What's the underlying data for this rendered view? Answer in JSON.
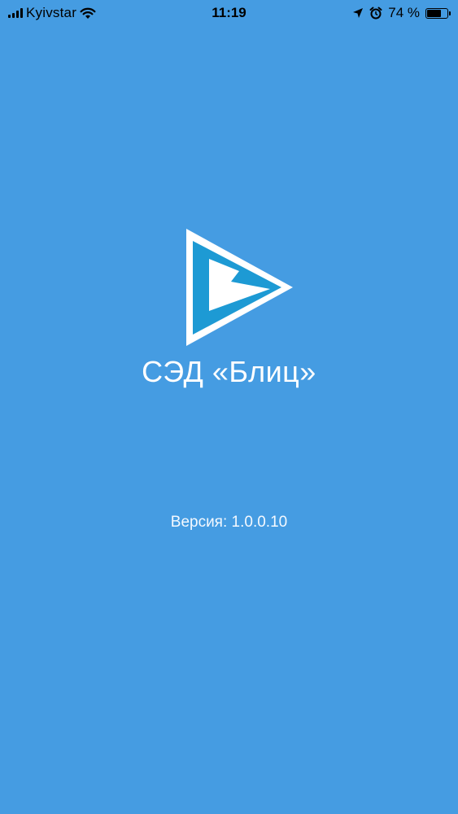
{
  "status_bar": {
    "carrier": "Kyivstar",
    "time": "11:19",
    "battery_percent": "74 %",
    "battery_level": 0.74,
    "signal_icon": "signal-bars-icon",
    "wifi_icon": "wifi-icon",
    "location_icon": "location-arrow-icon",
    "alarm_icon": "alarm-clock-icon",
    "battery_icon": "battery-icon"
  },
  "splash": {
    "background_color": "#459ce2",
    "logo_icon": "sed-blitz-logo-icon",
    "logo_colors": {
      "outline": "#ffffff",
      "fill": "#1d9ad4",
      "inner": "#ffffff"
    },
    "title": "СЭД «Блиц»",
    "version_label": "Версия:",
    "version_number": "1.0.0.10"
  }
}
